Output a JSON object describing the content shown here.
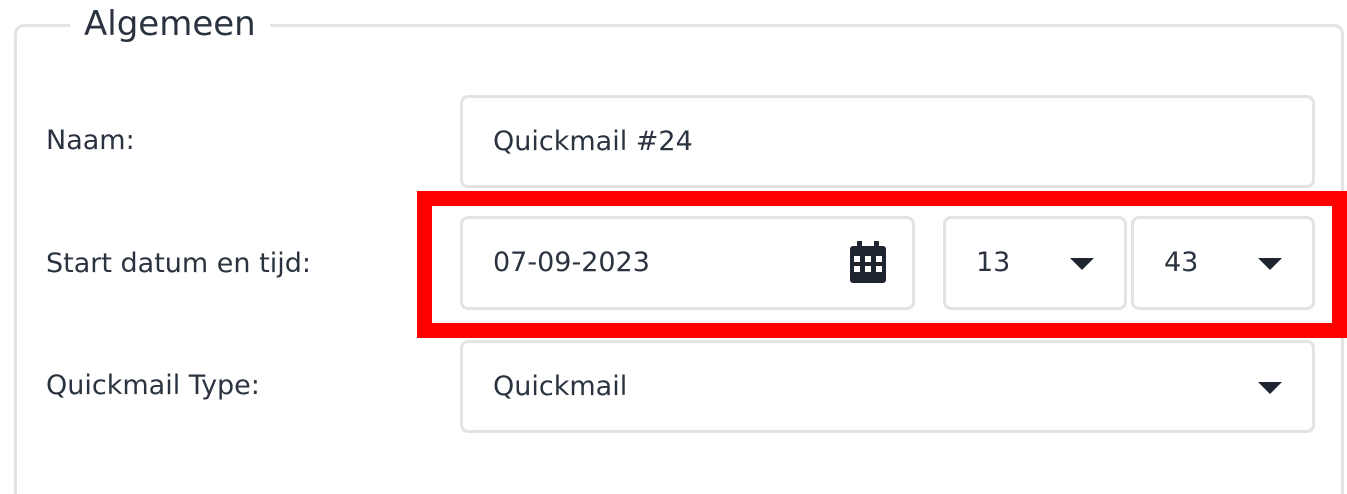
{
  "section": {
    "title": "Algemeen"
  },
  "form": {
    "name": {
      "label": "Naam:",
      "value": "Quickmail #24"
    },
    "start": {
      "label": "Start datum en tijd:",
      "date": "07-09-2023",
      "hour": "13",
      "minute": "43"
    },
    "type": {
      "label": "Quickmail Type:",
      "value": "Quickmail"
    }
  },
  "colors": {
    "highlight": "#ff0000",
    "border": "#e3e3e3",
    "text": "#2b3340"
  },
  "icons": {
    "date": "calendar-icon",
    "select": "chevron-down-icon"
  }
}
